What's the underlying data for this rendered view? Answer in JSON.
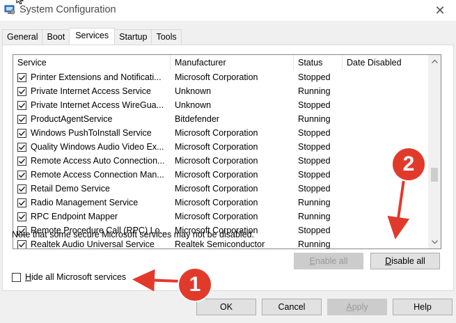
{
  "window": {
    "title": "System Configuration",
    "close_glyph": "✕"
  },
  "tabs": [
    {
      "label": "General",
      "active": false
    },
    {
      "label": "Boot",
      "active": false
    },
    {
      "label": "Services",
      "active": true
    },
    {
      "label": "Startup",
      "active": false
    },
    {
      "label": "Tools",
      "active": false
    }
  ],
  "services_list": {
    "columns": [
      "Service",
      "Manufacturer",
      "Status",
      "Date Disabled"
    ],
    "rows": [
      {
        "checked": true,
        "service": "Printer Extensions and Notificati...",
        "manufacturer": "Microsoft Corporation",
        "status": "Stopped",
        "date_disabled": ""
      },
      {
        "checked": true,
        "service": "Private Internet Access Service",
        "manufacturer": "Unknown",
        "status": "Running",
        "date_disabled": ""
      },
      {
        "checked": true,
        "service": "Private Internet Access WireGua...",
        "manufacturer": "Unknown",
        "status": "Stopped",
        "date_disabled": ""
      },
      {
        "checked": true,
        "service": "ProductAgentService",
        "manufacturer": "Bitdefender",
        "status": "Running",
        "date_disabled": ""
      },
      {
        "checked": true,
        "service": "Windows PushToInstall Service",
        "manufacturer": "Microsoft Corporation",
        "status": "Stopped",
        "date_disabled": ""
      },
      {
        "checked": true,
        "service": "Quality Windows Audio Video Ex...",
        "manufacturer": "Microsoft Corporation",
        "status": "Stopped",
        "date_disabled": ""
      },
      {
        "checked": true,
        "service": "Remote Access Auto Connection...",
        "manufacturer": "Microsoft Corporation",
        "status": "Stopped",
        "date_disabled": ""
      },
      {
        "checked": true,
        "service": "Remote Access Connection Man...",
        "manufacturer": "Microsoft Corporation",
        "status": "Stopped",
        "date_disabled": ""
      },
      {
        "checked": true,
        "service": "Retail Demo Service",
        "manufacturer": "Microsoft Corporation",
        "status": "Stopped",
        "date_disabled": ""
      },
      {
        "checked": true,
        "service": "Radio Management Service",
        "manufacturer": "Microsoft Corporation",
        "status": "Running",
        "date_disabled": ""
      },
      {
        "checked": true,
        "service": "RPC Endpoint Mapper",
        "manufacturer": "Microsoft Corporation",
        "status": "Running",
        "date_disabled": ""
      },
      {
        "checked": true,
        "service": "Remote Procedure Call (RPC) Lo...",
        "manufacturer": "Microsoft Corporation",
        "status": "Stopped",
        "date_disabled": ""
      },
      {
        "checked": true,
        "service": "Realtek Audio Universal Service",
        "manufacturer": "Realtek Semiconductor",
        "status": "Running",
        "date_disabled": ""
      }
    ]
  },
  "note": "Note that some secure Microsoft services may not be disabled.",
  "buttons": {
    "enable_all": {
      "accel": "E",
      "rest": "nable all"
    },
    "disable_all": {
      "accel": "D",
      "rest": "isable all"
    },
    "ok": "OK",
    "cancel": "Cancel",
    "apply": {
      "accel": "A",
      "rest": "pply"
    },
    "help": "Help"
  },
  "hide_ms": {
    "accel": "H",
    "rest": "ide all Microsoft services",
    "checked": false
  },
  "annotations": {
    "marker_1": "1",
    "marker_2": "2",
    "color": "#e13a2b"
  }
}
